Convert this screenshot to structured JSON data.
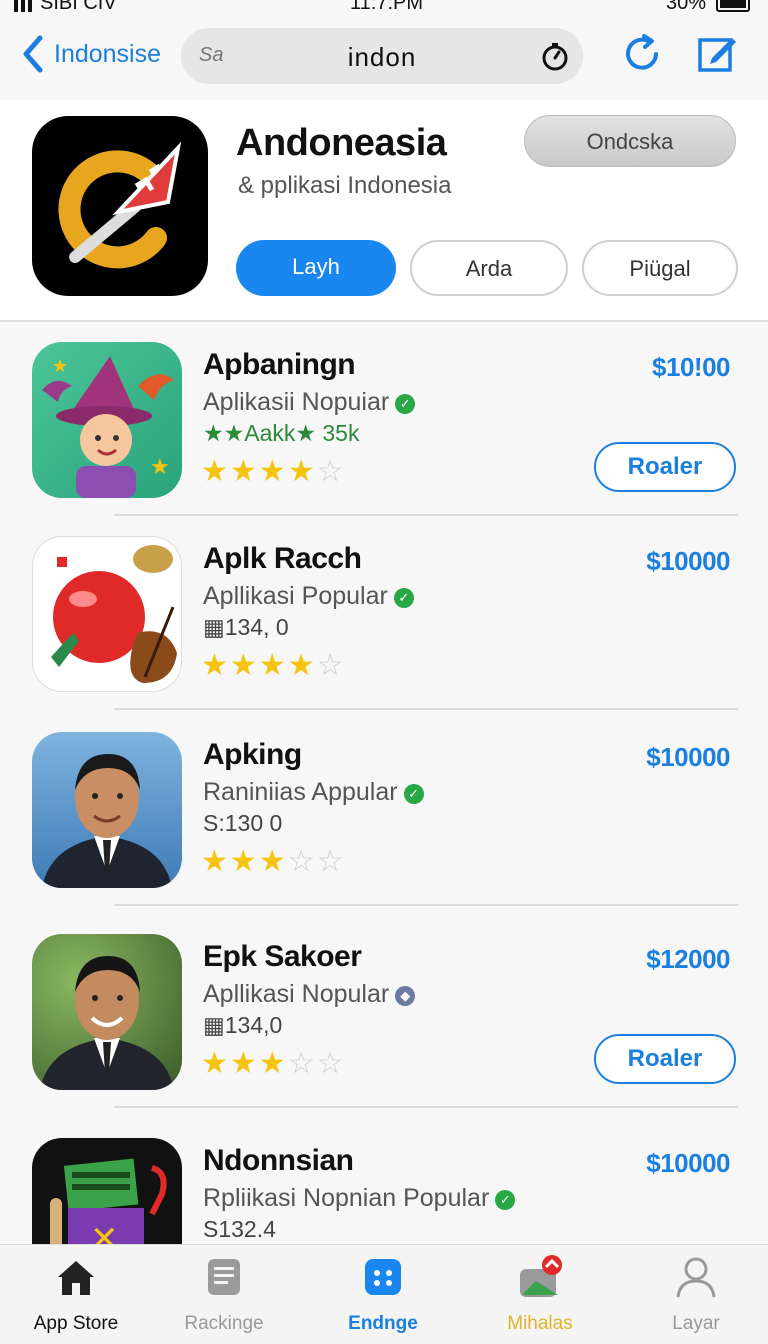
{
  "status_bar": {
    "carrier": "SIBI CIV",
    "time": "11:7:PM",
    "battery": "30%"
  },
  "nav": {
    "back_label": "Indonsise",
    "search_value": "indon",
    "search_prefix": "Sa"
  },
  "header": {
    "title": "Andoneasia",
    "subtitle": "& pplikasi Indonesia",
    "top_pill": "Ondcska",
    "segments": [
      "Layh",
      "Arda",
      "Piügal"
    ]
  },
  "apps": [
    {
      "name": "Apbaningn",
      "subtitle": "Aplikasii Nopuiar",
      "meta": "★★Aakk★ 35k",
      "rating": 3.5,
      "price": "$10!00",
      "action": "Roaler"
    },
    {
      "name": "Aplk Racch",
      "subtitle": "Apllikasi Popular",
      "meta": "▦134, 0",
      "rating": 3.5,
      "price": "$10000",
      "action": ""
    },
    {
      "name": "Apking",
      "subtitle": "Raniniias Appular",
      "meta": "S:130 0",
      "rating": 2.5,
      "price": "$10000",
      "action": ""
    },
    {
      "name": "Epk Sakoer",
      "subtitle": "Apllikasi Nopular",
      "meta": "▦134,0",
      "rating": 3,
      "price": "$12000",
      "action": "Roaler"
    },
    {
      "name": "Ndonnsian",
      "subtitle": "Rpliikasi Nopnian Popular",
      "meta": "S132.4",
      "rating": 0,
      "price": "$10000",
      "action": ""
    }
  ],
  "tabs": [
    "App Store",
    "Rackinge",
    "Endnge",
    "Mihalas",
    "Layar"
  ],
  "colors": {
    "accent": "#1a7fe0",
    "star": "#f5c40f",
    "badge": "#29a745"
  }
}
